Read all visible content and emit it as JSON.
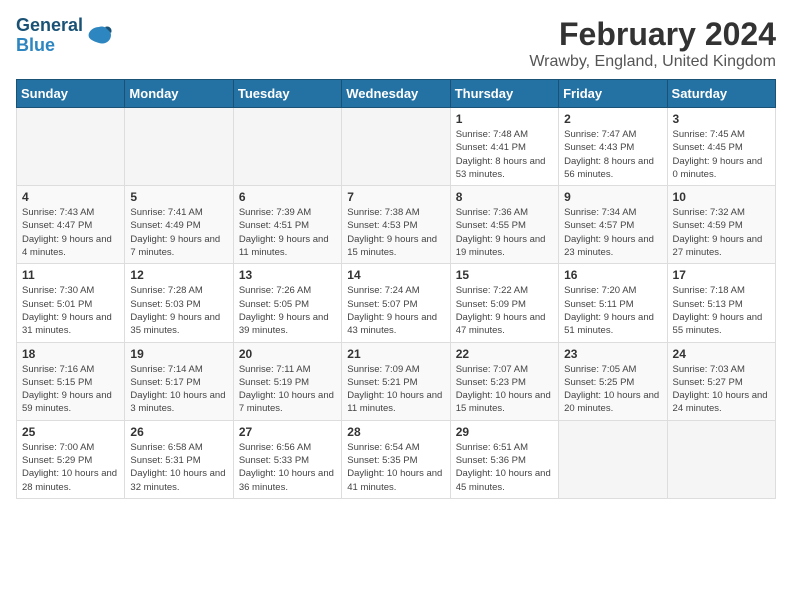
{
  "logo": {
    "text_general": "General",
    "text_blue": "Blue"
  },
  "header": {
    "title": "February 2024",
    "subtitle": "Wrawby, England, United Kingdom"
  },
  "weekdays": [
    "Sunday",
    "Monday",
    "Tuesday",
    "Wednesday",
    "Thursday",
    "Friday",
    "Saturday"
  ],
  "weeks": [
    [
      {
        "day": "",
        "sunrise": "",
        "sunset": "",
        "daylight": ""
      },
      {
        "day": "",
        "sunrise": "",
        "sunset": "",
        "daylight": ""
      },
      {
        "day": "",
        "sunrise": "",
        "sunset": "",
        "daylight": ""
      },
      {
        "day": "",
        "sunrise": "",
        "sunset": "",
        "daylight": ""
      },
      {
        "day": "1",
        "sunrise": "Sunrise: 7:48 AM",
        "sunset": "Sunset: 4:41 PM",
        "daylight": "Daylight: 8 hours and 53 minutes."
      },
      {
        "day": "2",
        "sunrise": "Sunrise: 7:47 AM",
        "sunset": "Sunset: 4:43 PM",
        "daylight": "Daylight: 8 hours and 56 minutes."
      },
      {
        "day": "3",
        "sunrise": "Sunrise: 7:45 AM",
        "sunset": "Sunset: 4:45 PM",
        "daylight": "Daylight: 9 hours and 0 minutes."
      }
    ],
    [
      {
        "day": "4",
        "sunrise": "Sunrise: 7:43 AM",
        "sunset": "Sunset: 4:47 PM",
        "daylight": "Daylight: 9 hours and 4 minutes."
      },
      {
        "day": "5",
        "sunrise": "Sunrise: 7:41 AM",
        "sunset": "Sunset: 4:49 PM",
        "daylight": "Daylight: 9 hours and 7 minutes."
      },
      {
        "day": "6",
        "sunrise": "Sunrise: 7:39 AM",
        "sunset": "Sunset: 4:51 PM",
        "daylight": "Daylight: 9 hours and 11 minutes."
      },
      {
        "day": "7",
        "sunrise": "Sunrise: 7:38 AM",
        "sunset": "Sunset: 4:53 PM",
        "daylight": "Daylight: 9 hours and 15 minutes."
      },
      {
        "day": "8",
        "sunrise": "Sunrise: 7:36 AM",
        "sunset": "Sunset: 4:55 PM",
        "daylight": "Daylight: 9 hours and 19 minutes."
      },
      {
        "day": "9",
        "sunrise": "Sunrise: 7:34 AM",
        "sunset": "Sunset: 4:57 PM",
        "daylight": "Daylight: 9 hours and 23 minutes."
      },
      {
        "day": "10",
        "sunrise": "Sunrise: 7:32 AM",
        "sunset": "Sunset: 4:59 PM",
        "daylight": "Daylight: 9 hours and 27 minutes."
      }
    ],
    [
      {
        "day": "11",
        "sunrise": "Sunrise: 7:30 AM",
        "sunset": "Sunset: 5:01 PM",
        "daylight": "Daylight: 9 hours and 31 minutes."
      },
      {
        "day": "12",
        "sunrise": "Sunrise: 7:28 AM",
        "sunset": "Sunset: 5:03 PM",
        "daylight": "Daylight: 9 hours and 35 minutes."
      },
      {
        "day": "13",
        "sunrise": "Sunrise: 7:26 AM",
        "sunset": "Sunset: 5:05 PM",
        "daylight": "Daylight: 9 hours and 39 minutes."
      },
      {
        "day": "14",
        "sunrise": "Sunrise: 7:24 AM",
        "sunset": "Sunset: 5:07 PM",
        "daylight": "Daylight: 9 hours and 43 minutes."
      },
      {
        "day": "15",
        "sunrise": "Sunrise: 7:22 AM",
        "sunset": "Sunset: 5:09 PM",
        "daylight": "Daylight: 9 hours and 47 minutes."
      },
      {
        "day": "16",
        "sunrise": "Sunrise: 7:20 AM",
        "sunset": "Sunset: 5:11 PM",
        "daylight": "Daylight: 9 hours and 51 minutes."
      },
      {
        "day": "17",
        "sunrise": "Sunrise: 7:18 AM",
        "sunset": "Sunset: 5:13 PM",
        "daylight": "Daylight: 9 hours and 55 minutes."
      }
    ],
    [
      {
        "day": "18",
        "sunrise": "Sunrise: 7:16 AM",
        "sunset": "Sunset: 5:15 PM",
        "daylight": "Daylight: 9 hours and 59 minutes."
      },
      {
        "day": "19",
        "sunrise": "Sunrise: 7:14 AM",
        "sunset": "Sunset: 5:17 PM",
        "daylight": "Daylight: 10 hours and 3 minutes."
      },
      {
        "day": "20",
        "sunrise": "Sunrise: 7:11 AM",
        "sunset": "Sunset: 5:19 PM",
        "daylight": "Daylight: 10 hours and 7 minutes."
      },
      {
        "day": "21",
        "sunrise": "Sunrise: 7:09 AM",
        "sunset": "Sunset: 5:21 PM",
        "daylight": "Daylight: 10 hours and 11 minutes."
      },
      {
        "day": "22",
        "sunrise": "Sunrise: 7:07 AM",
        "sunset": "Sunset: 5:23 PM",
        "daylight": "Daylight: 10 hours and 15 minutes."
      },
      {
        "day": "23",
        "sunrise": "Sunrise: 7:05 AM",
        "sunset": "Sunset: 5:25 PM",
        "daylight": "Daylight: 10 hours and 20 minutes."
      },
      {
        "day": "24",
        "sunrise": "Sunrise: 7:03 AM",
        "sunset": "Sunset: 5:27 PM",
        "daylight": "Daylight: 10 hours and 24 minutes."
      }
    ],
    [
      {
        "day": "25",
        "sunrise": "Sunrise: 7:00 AM",
        "sunset": "Sunset: 5:29 PM",
        "daylight": "Daylight: 10 hours and 28 minutes."
      },
      {
        "day": "26",
        "sunrise": "Sunrise: 6:58 AM",
        "sunset": "Sunset: 5:31 PM",
        "daylight": "Daylight: 10 hours and 32 minutes."
      },
      {
        "day": "27",
        "sunrise": "Sunrise: 6:56 AM",
        "sunset": "Sunset: 5:33 PM",
        "daylight": "Daylight: 10 hours and 36 minutes."
      },
      {
        "day": "28",
        "sunrise": "Sunrise: 6:54 AM",
        "sunset": "Sunset: 5:35 PM",
        "daylight": "Daylight: 10 hours and 41 minutes."
      },
      {
        "day": "29",
        "sunrise": "Sunrise: 6:51 AM",
        "sunset": "Sunset: 5:36 PM",
        "daylight": "Daylight: 10 hours and 45 minutes."
      },
      {
        "day": "",
        "sunrise": "",
        "sunset": "",
        "daylight": ""
      },
      {
        "day": "",
        "sunrise": "",
        "sunset": "",
        "daylight": ""
      }
    ]
  ]
}
